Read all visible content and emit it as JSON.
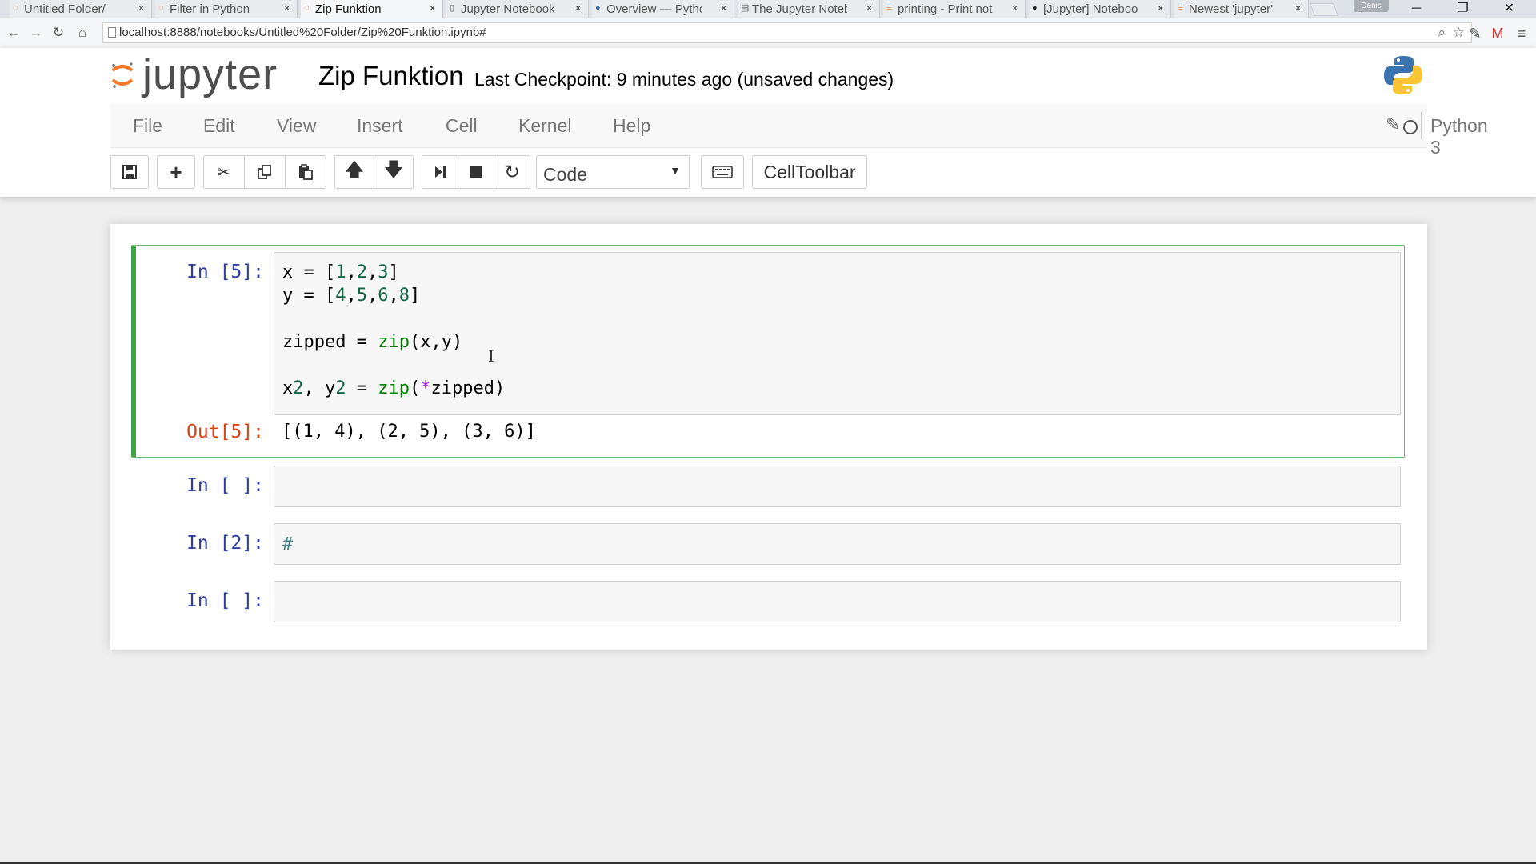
{
  "browser": {
    "tabs": [
      {
        "label": "Untitled Folder/",
        "active": false
      },
      {
        "label": "Filter in Python",
        "active": false
      },
      {
        "label": "Zip Funktion",
        "active": true
      },
      {
        "label": "Jupyter Notebook",
        "active": false
      },
      {
        "label": "Overview — Python",
        "active": false
      },
      {
        "label": "The Jupyter Noteb",
        "active": false
      },
      {
        "label": "printing - Print not",
        "active": false
      },
      {
        "label": "[Jupyter] Noteboo",
        "active": false
      },
      {
        "label": "Newest 'jupyter' Q",
        "active": false
      }
    ],
    "close_glyph": "×",
    "user_badge": "Denis",
    "url": "localhost:8888/notebooks/Untitled%20Folder/Zip%20Funktion.ipynb#"
  },
  "header": {
    "logo_text": "jupyter",
    "notebook_title": "Zip Funktion",
    "checkpoint": "Last Checkpoint: 9 minutes ago (unsaved changes)"
  },
  "menubar": {
    "items": [
      "File",
      "Edit",
      "View",
      "Insert",
      "Cell",
      "Kernel",
      "Help"
    ],
    "kernel_name": "Python 3"
  },
  "toolbar": {
    "cell_type": "Code",
    "celltoolbar_label": "CellToolbar"
  },
  "cells": [
    {
      "prompt": "In [5]:",
      "code_lines": [
        "x = [1,2,3]",
        "y = [4,5,6,8]",
        "",
        "zipped = zip(x,y)",
        "",
        "x2, y2 = zip(*zipped)"
      ],
      "out_prompt": "Out[5]:",
      "output": "[(1, 4), (2, 5), (3, 6)]",
      "selected": true
    },
    {
      "prompt": "In [ ]:",
      "code": ""
    },
    {
      "prompt": "In [2]:",
      "code": "#"
    },
    {
      "prompt": "In [ ]:",
      "code": ""
    }
  ],
  "colors": {
    "selected_border": "#42a545",
    "prompt_in": "#303f9f",
    "prompt_out": "#d84315",
    "logo_orange": "#f37726"
  }
}
